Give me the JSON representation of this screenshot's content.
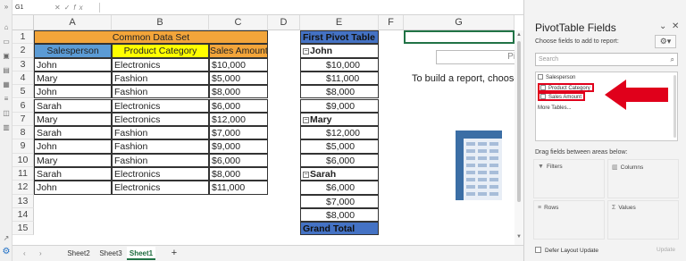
{
  "formula_bar": {
    "name_box": "G1",
    "fx": "fx",
    "buttons": [
      "✕",
      "✓"
    ]
  },
  "columns": [
    "A",
    "B",
    "C",
    "D",
    "E",
    "F",
    "G"
  ],
  "rows": [
    "1",
    "2",
    "3",
    "4",
    "5",
    "6",
    "7",
    "8",
    "9",
    "10",
    "11",
    "12",
    "13",
    "14",
    "15"
  ],
  "data_table": {
    "title": "Common Data Set",
    "headers": [
      "Salesperson",
      "Product Category",
      "Sales Amount"
    ],
    "rows": [
      [
        "John",
        "Electronics",
        "$10,000"
      ],
      [
        "Mary",
        "Fashion",
        "$5,000"
      ],
      [
        "John",
        "Fashion",
        "$8,000"
      ],
      [
        "Sarah",
        "Electronics",
        "$6,000"
      ],
      [
        "Mary",
        "Electronics",
        "$12,000"
      ],
      [
        "Sarah",
        "Fashion",
        "$7,000"
      ],
      [
        "John",
        "Fashion",
        "$9,000"
      ],
      [
        "Mary",
        "Fashion",
        "$6,000"
      ],
      [
        "Sarah",
        "Electronics",
        "$8,000"
      ],
      [
        "John",
        "Electronics",
        "$11,000"
      ]
    ]
  },
  "pivot": {
    "header": "First Pivot Table",
    "groups": [
      {
        "name": "John",
        "values": [
          "$10,000",
          "$11,000",
          "$8,000",
          "$9,000"
        ]
      },
      {
        "name": "Mary",
        "values": [
          "$12,000",
          "$5,000",
          "$6,000"
        ]
      },
      {
        "name": "Sarah",
        "values": [
          "$6,000",
          "$7,000",
          "$8,000"
        ]
      }
    ],
    "grand_total": "Grand Total",
    "placeholder_label": "Piv",
    "build_text": "To build a report, choose"
  },
  "sheet_tabs": {
    "items": [
      "Sheet2",
      "Sheet3",
      "Sheet1"
    ],
    "active": "Sheet1",
    "add": "+"
  },
  "pane": {
    "title": "PivotTable Fields",
    "subtitle": "Choose fields to add to report:",
    "search_placeholder": "Search",
    "fields": [
      "Salesperson",
      "Product Category",
      "Sales Amount"
    ],
    "more_tables": "More Tables...",
    "drag_text": "Drag fields between areas below:",
    "areas": [
      "Filters",
      "Columns",
      "Rows",
      "Values"
    ],
    "defer_label": "Defer Layout Update",
    "update_label": "Update"
  },
  "colors": {
    "orange": "#f3a53a",
    "blue": "#5b9bd5",
    "yellow": "#ffff00",
    "pivot_blue": "#4472c4",
    "arrow_red": "#e0001b",
    "excel_green": "#217346"
  }
}
